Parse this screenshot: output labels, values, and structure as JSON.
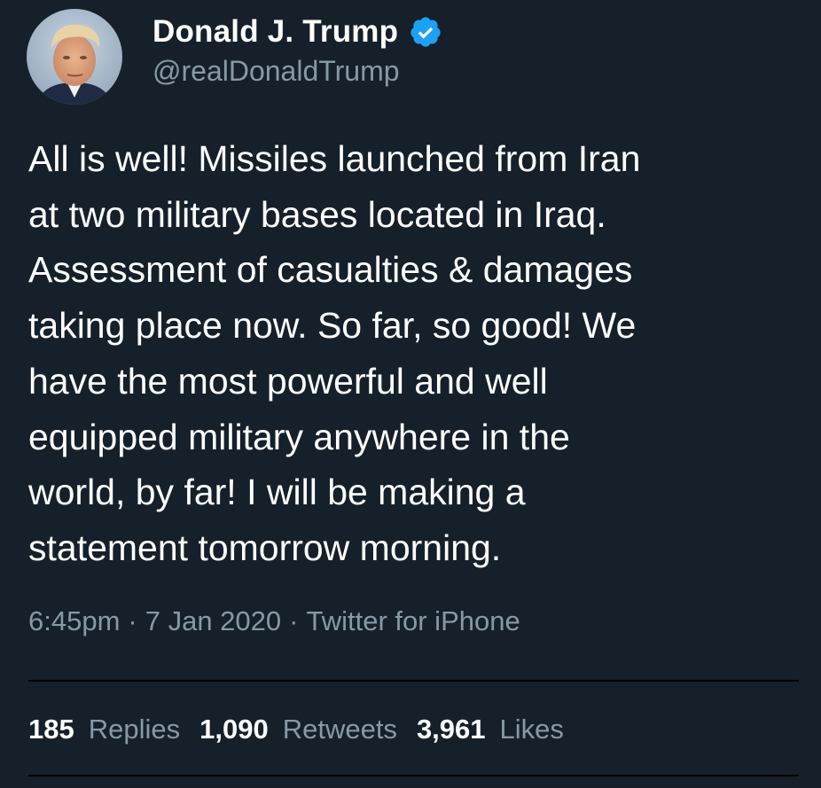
{
  "user": {
    "display_name": "Donald J. Trump",
    "handle": "@realDonaldTrump",
    "verified": true
  },
  "tweet": {
    "text_lines": [
      "All is well! Missiles launched from Iran",
      "at two military bases located in Iraq.",
      "Assessment of casualties & damages",
      "taking place now. So far, so good! We",
      "have the most powerful and well",
      "equipped military anywhere in the",
      "world, by far! I will be making a",
      "statement tomorrow morning."
    ]
  },
  "meta": {
    "time": "6:45pm",
    "date": "7 Jan 2020",
    "source": "Twitter for iPhone",
    "separator": "·"
  },
  "stats": {
    "replies_count": "185",
    "replies_label": "Replies",
    "retweets_count": "1,090",
    "retweets_label": "Retweets",
    "likes_count": "3,961",
    "likes_label": "Likes"
  },
  "colors": {
    "background": "#15202b",
    "text_primary": "#ffffff",
    "text_secondary": "#8899a6",
    "verified_badge": "#1da1f2",
    "divider": "#000000"
  }
}
